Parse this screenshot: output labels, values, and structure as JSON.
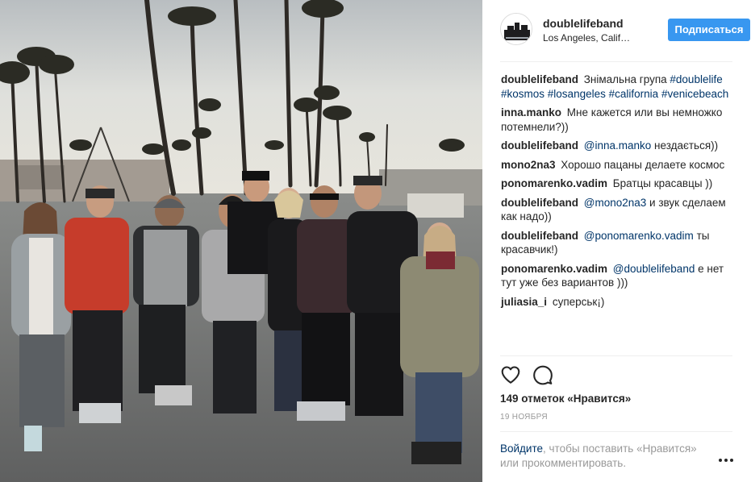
{
  "post": {
    "username": "doublelifeband",
    "location": "Los Angeles, California",
    "follow_label": "Подписаться",
    "caption": {
      "author": "doublelifeband",
      "text": "Знімальна група",
      "hashtags": [
        "#doublelife",
        "#kosmos",
        "#losangeles",
        "#california",
        "#venicebeach"
      ]
    },
    "comments": [
      {
        "author": "inna.manko",
        "text": "Мне кажется или вы немножко потемнели?))"
      },
      {
        "author": "doublelifeband",
        "mention": "@inna.manko",
        "text": "нездається))"
      },
      {
        "author": "mono2na3",
        "text": "Хорошо пацаны делаете космос"
      },
      {
        "author": "ponomarenko.vadim",
        "text": "Братцы красавцы ))"
      },
      {
        "author": "doublelifeband",
        "mention": "@mono2na3",
        "text": "и звук сделаем как надо))"
      },
      {
        "author": "doublelifeband",
        "mention": "@ponomarenko.vadim",
        "text": "ты красавчик!)"
      },
      {
        "author": "ponomarenko.vadim",
        "mention": "@doublelifeband",
        "text": "е нет тут уже без вариантов )))"
      },
      {
        "author": "juliasia_i",
        "text": "суперськ¡)"
      }
    ],
    "likes_text": "149 отметок «Нравится»",
    "date": "19 НОЯБРЯ",
    "login_prompt": {
      "link": "Войдите",
      "text": ", чтобы поставить «Нравится» или прокомментировать."
    }
  },
  "icons": {
    "like": "heart-outline-icon",
    "comment": "speech-bubble-icon",
    "more": "more-options-icon"
  },
  "colors": {
    "accent": "#3897f0",
    "link": "#003569",
    "text": "#262626",
    "muted": "#999999",
    "divider": "#efefef"
  }
}
